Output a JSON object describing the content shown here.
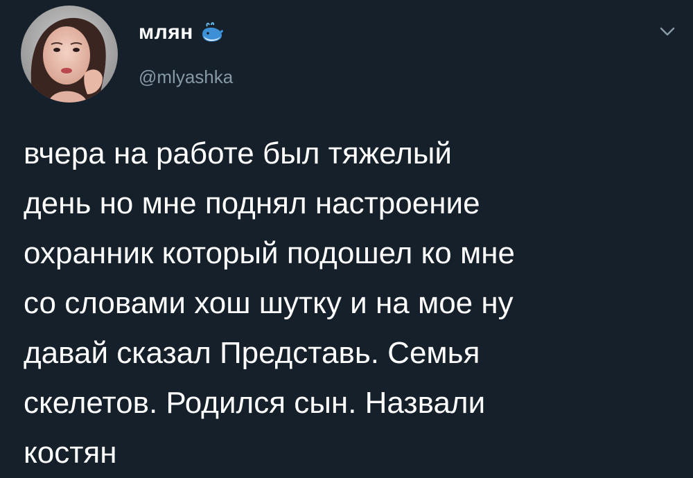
{
  "author": {
    "display_name": "млян",
    "badge_emoji_icon": "whale-emoji-icon",
    "handle": "@mlyashka",
    "avatar_icon": "profile-photo"
  },
  "menu": {
    "caret_icon": "chevron-down-icon"
  },
  "tweet": {
    "lines": [
      "вчера на работе был тяжелый",
      "день но мне поднял настроение",
      "охранник который подошел ко мне",
      "со словами хош шутку и на мое ну",
      "давай сказал Представь. Семья",
      "скелетов. Родился сын. Назвали",
      "костян"
    ]
  },
  "colors": {
    "background": "#15202b",
    "text_primary": "#ffffff",
    "text_secondary": "#8899a6"
  }
}
